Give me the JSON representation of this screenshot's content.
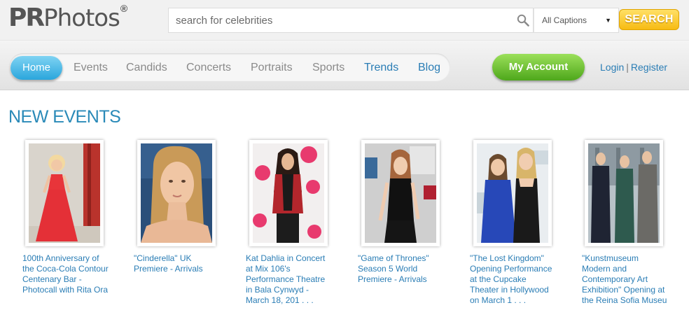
{
  "logo": {
    "part1": "PR",
    "part2": "Photos",
    "mark": "®"
  },
  "search": {
    "placeholder": "search for celebrities",
    "caption_filter": "All Captions",
    "button": "SEARCH"
  },
  "nav": {
    "items": [
      {
        "label": "Home",
        "active": true
      },
      {
        "label": "Events"
      },
      {
        "label": "Candids"
      },
      {
        "label": "Concerts"
      },
      {
        "label": "Portraits"
      },
      {
        "label": "Sports"
      },
      {
        "label": "Trends"
      },
      {
        "label": "Blog"
      }
    ],
    "account_button": "My Account",
    "login": "Login",
    "separator": "|",
    "register": "Register"
  },
  "section": {
    "title": "NEW EVENTS"
  },
  "events": [
    {
      "caption": "100th Anniversary of the Coca-Cola Contour Centenary Bar - Photocall with Rita Ora"
    },
    {
      "caption": "\"Cinderella\" UK Premiere - Arrivals"
    },
    {
      "caption": "Kat Dahlia in Concert at Mix 106's Performance Theatre in Bala Cynwyd - March 18, 201 . . ."
    },
    {
      "caption": "\"Game of Thrones\" Season 5 World Premiere - Arrivals"
    },
    {
      "caption": "\"The Lost Kingdom\" Opening Performance at the Cupcake Theater in Hollywood on March 1 . . ."
    },
    {
      "caption": "\"Kunstmuseum Modern and Contemporary Art Exhibition\" Opening at the Reina Sofia Museu"
    }
  ],
  "colors": {
    "link": "#2a7db5",
    "title": "#2a8ab8",
    "home_pill": "#2aa6dc",
    "account_button": "#4ea71b",
    "search_button": "#f7bb12"
  },
  "icons": {
    "search": "magnifier-icon",
    "dropdown": "triangle-down-icon"
  }
}
